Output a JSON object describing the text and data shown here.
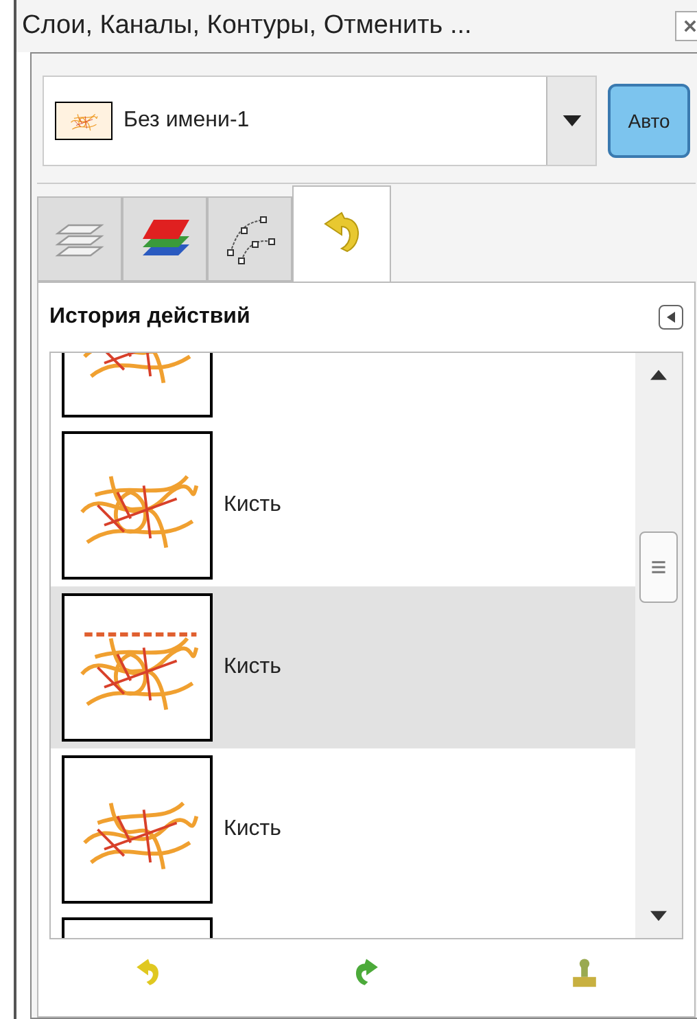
{
  "window": {
    "title": "Слои, Каналы, Контуры, Отменить ..."
  },
  "image_selector": {
    "name": "Без имени-1",
    "auto_button": "Авто"
  },
  "tabs": [
    {
      "kind": "layers",
      "selected": false
    },
    {
      "kind": "channels",
      "selected": false
    },
    {
      "kind": "paths",
      "selected": false
    },
    {
      "kind": "undo",
      "selected": true
    }
  ],
  "panel": {
    "title": "История действий"
  },
  "history": [
    {
      "selected": false
    },
    {
      "label": "Кисть",
      "selected": false
    },
    {
      "label": "Кисть",
      "selected": true
    },
    {
      "label": "Кисть",
      "selected": false
    },
    {
      "selected": false
    }
  ]
}
